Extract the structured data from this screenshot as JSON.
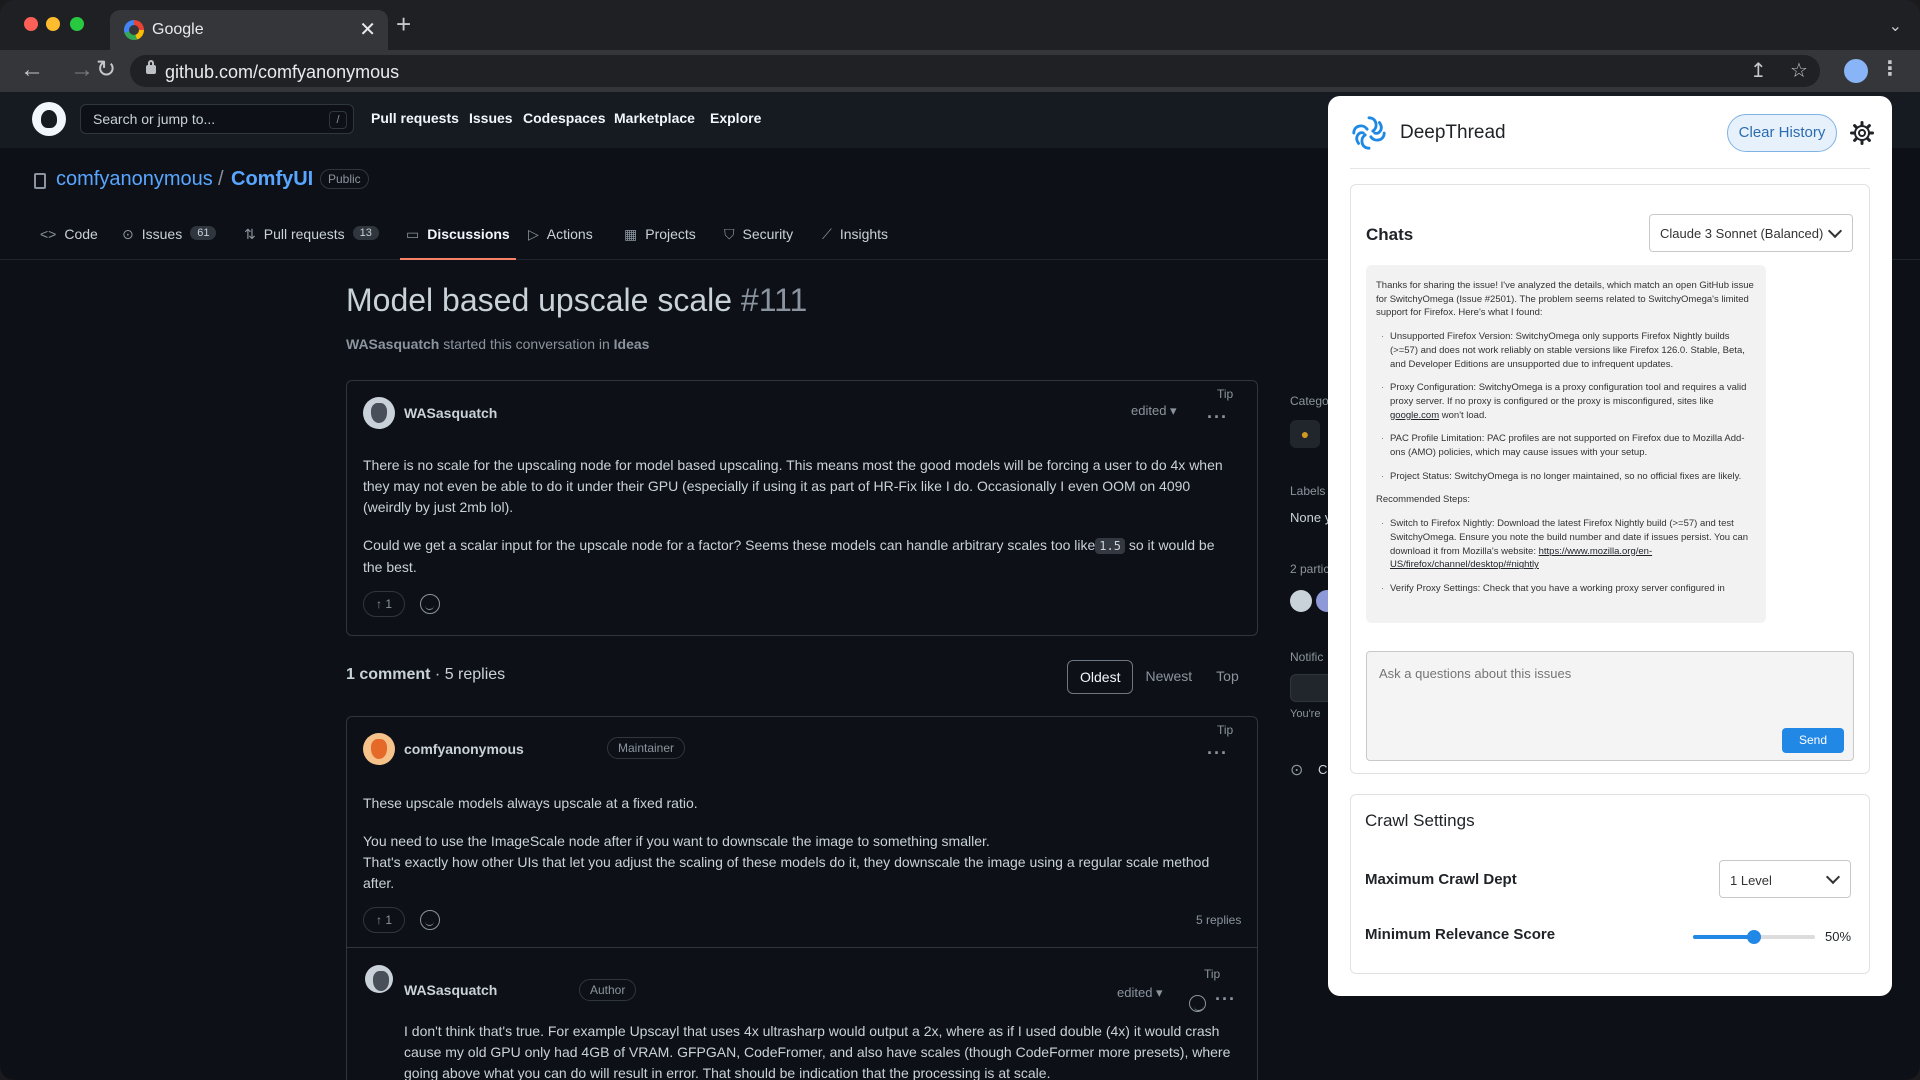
{
  "browser": {
    "tab_title": "Google",
    "url": "github.com/comfyanonymous"
  },
  "gh": {
    "search_placeholder": "Search or jump to...",
    "search_key": "/",
    "nav": [
      "Pull requests",
      "Issues",
      "Codespaces",
      "Marketplace",
      "Explore"
    ]
  },
  "repo": {
    "owner": "comfyanonymous",
    "slash": "/",
    "name": "ComfyUI",
    "visibility": "Public",
    "tabs": [
      {
        "label": "Code",
        "icon": "code-icon",
        "count": ""
      },
      {
        "label": "Issues",
        "icon": "issue-icon",
        "count": "61"
      },
      {
        "label": "Pull requests",
        "icon": "pull-request-icon",
        "count": "13"
      },
      {
        "label": "Discussions",
        "icon": "discussion-icon",
        "count": ""
      },
      {
        "label": "Actions",
        "icon": "play-icon",
        "count": ""
      },
      {
        "label": "Projects",
        "icon": "table-icon",
        "count": ""
      },
      {
        "label": "Security",
        "icon": "shield-icon",
        "count": ""
      },
      {
        "label": "Insights",
        "icon": "graph-icon",
        "count": ""
      }
    ]
  },
  "discussion": {
    "title": "Model based upscale scale",
    "number": "#111",
    "starter": "WASasquatch",
    "started_text": "started this conversation in",
    "category": "Ideas",
    "post": {
      "author": "WASasquatch",
      "tip": "Tip",
      "edited": "edited",
      "p1": "There is no scale for the upscaling node for model based upscaling. This means most the good models will be forcing a user to do 4x when they may not even be able to do it under their GPU (especially if using it as part of HR-Fix like I do. Occasionally I even OOM on 4090 (weirdly by just 2mb lol).",
      "p2_a": "Could we get a scalar input for the upscale node for a factor? Seems these models can handle arbitrary scales too like",
      "p2_code": "1.5",
      "p2_b": "so it would be the best.",
      "votes": "1"
    },
    "comments_label": "1 comment",
    "replies_label": "· 5 replies",
    "sort": [
      "Oldest",
      "Newest",
      "Top"
    ],
    "comment": {
      "author": "comfyanonymous",
      "badge": "Maintainer",
      "tip": "Tip",
      "p1": "These upscale models always upscale at a fixed ratio.",
      "p2": "You need to use the ImageScale node after if you want to downscale the image to something smaller.",
      "p3": "That's exactly how other UIs that let you adjust the scaling of these models do it, they downscale the image using a regular scale method after.",
      "votes": "1",
      "replies": "5 replies"
    },
    "reply": {
      "author": "WASasquatch",
      "badge": "Author",
      "tip": "Tip",
      "edited": "edited",
      "text": "I don't think that's true. For example Upscayl that uses 4x ultrasharp would output a 2x, where as if I used double (4x) it would crash cause my old GPU only had 4GB of VRAM. GFPGAN, CodeFromer, and also have scales (though CodeFormer more presets), where going above what you can do will result in error. That should be indication that the processing is at scale."
    }
  },
  "gh_sidebar": {
    "category": "Catego",
    "labels": "Labels",
    "labels_value": "None y",
    "participants": "2 partic",
    "notifications": "Notific",
    "youre": "You're",
    "more": "C"
  },
  "deepthread": {
    "title": "DeepThread",
    "clear_history": "Clear History",
    "chats_heading": "Chats",
    "model": "Claude 3 Sonnet (Balanced)",
    "message": {
      "intro": "Thanks for sharing the issue! I've analyzed the details, which match an open GitHub issue for SwitchyOmega (Issue #2501). The problem seems related to SwitchyOmega's limited support for Firefox. Here's what I found:",
      "findings": [
        "Unsupported Firefox Version: SwitchyOmega only supports Firefox Nightly builds (>=57) and does not work reliably on stable versions like Firefox 126.0. Stable, Beta, and Developer Editions are unsupported due to infrequent updates.",
        "PAC Profile Limitation: PAC profiles are not supported on Firefox due to Mozilla Add-ons (AMO) policies, which may cause issues with your setup.",
        "Project Status: SwitchyOmega is no longer maintained, so no official fixes are likely."
      ],
      "proxy_a": "Proxy Configuration: SwitchyOmega is a proxy configuration tool and requires a valid proxy server. If no proxy is configured or the proxy is misconfigured, sites like",
      "proxy_link": "google.com",
      "proxy_b": "won't load.",
      "steps_heading": "Recommended Steps:",
      "step1_a": "Switch to Firefox Nightly: Download the latest Firefox Nightly build (>=57) and test SwitchyOmega. Ensure you note the build number and date if issues persist. You can download it from Mozilla's website:",
      "step1_link": "https://www.mozilla.org/en-US/firefox/channel/desktop/#nightly",
      "step2": "Verify Proxy Settings: Check that you have a working proxy server configured in"
    },
    "input_placeholder": "Ask a questions about this issues",
    "send": "Send",
    "crawl_heading": "Crawl Settings",
    "depth_label": "Maximum Crawl Dept",
    "depth_value": "1 Level",
    "relevance_label": "Minimum Relevance Score",
    "relevance_value": 50,
    "relevance_text": "50%"
  }
}
